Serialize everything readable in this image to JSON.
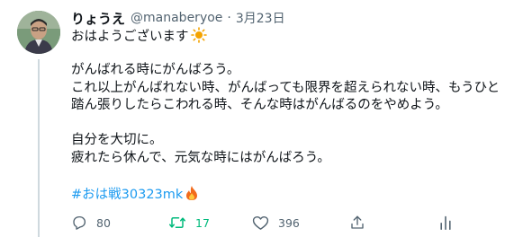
{
  "tweet": {
    "display_name": "りょうえ",
    "handle": "@manaberyoe",
    "separator": "·",
    "timestamp": "3月23日",
    "greeting": "おはようございます",
    "lines": [
      "がんばれる時にがんばろう。",
      "これ以上がんばれない時、がんばっても限界を超えられない時、もうひと",
      "踏ん張りしたらこわれる時、そんな時はがんばるのをやめよう。",
      "自分を大切に。",
      "疲れたら休んで、元気な時にはがんばろう。"
    ],
    "hashtag": "#おは戦30323mk"
  },
  "icons": {
    "greeting_emoji": "sun-icon",
    "hashtag_emoji": "fire-icon",
    "reply": "reply-icon",
    "retweet": "retweet-icon",
    "like": "heart-icon",
    "share": "share-icon",
    "analytics": "analytics-icon"
  },
  "actions": {
    "reply_count": "80",
    "retweet_count": "17",
    "like_count": "396"
  },
  "colors": {
    "link": "#1d9bf0",
    "retweet_active": "#00ba7c",
    "muted": "#536471",
    "sun": "#f4a300",
    "fire": "#f26b1d"
  }
}
